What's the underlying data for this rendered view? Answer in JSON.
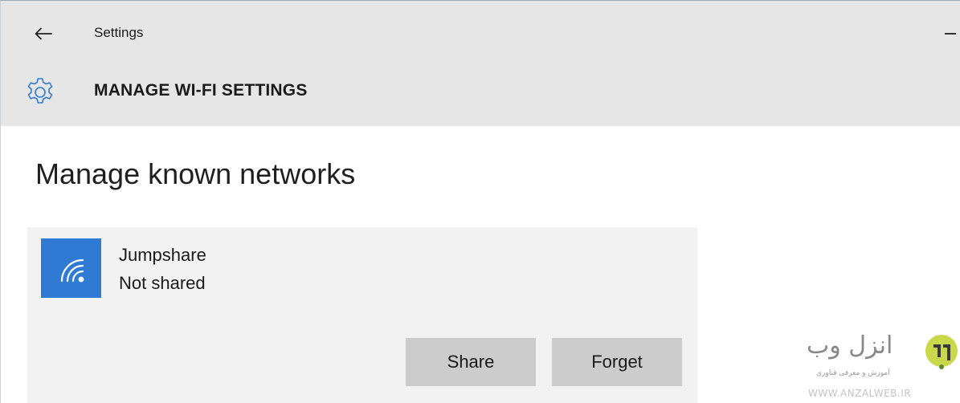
{
  "window": {
    "title": "Settings"
  },
  "header": {
    "section_title": "MANAGE WI-FI SETTINGS",
    "section_icon": "gear-icon"
  },
  "main": {
    "heading": "Manage known networks",
    "networks": [
      {
        "name": "Jumpshare",
        "status": "Not shared",
        "icon": "wifi-icon",
        "actions": {
          "share_label": "Share",
          "forget_label": "Forget"
        }
      }
    ]
  },
  "watermark": {
    "brand": "انزل وب",
    "tagline": "آموزش و معرفی فناوری",
    "url": "WWW.ANZALWEB.IR"
  },
  "colors": {
    "header_bg": "#e6e6e6",
    "card_bg": "#f2f2f2",
    "accent": "#2f7bd4",
    "button_bg": "#cccccc"
  }
}
